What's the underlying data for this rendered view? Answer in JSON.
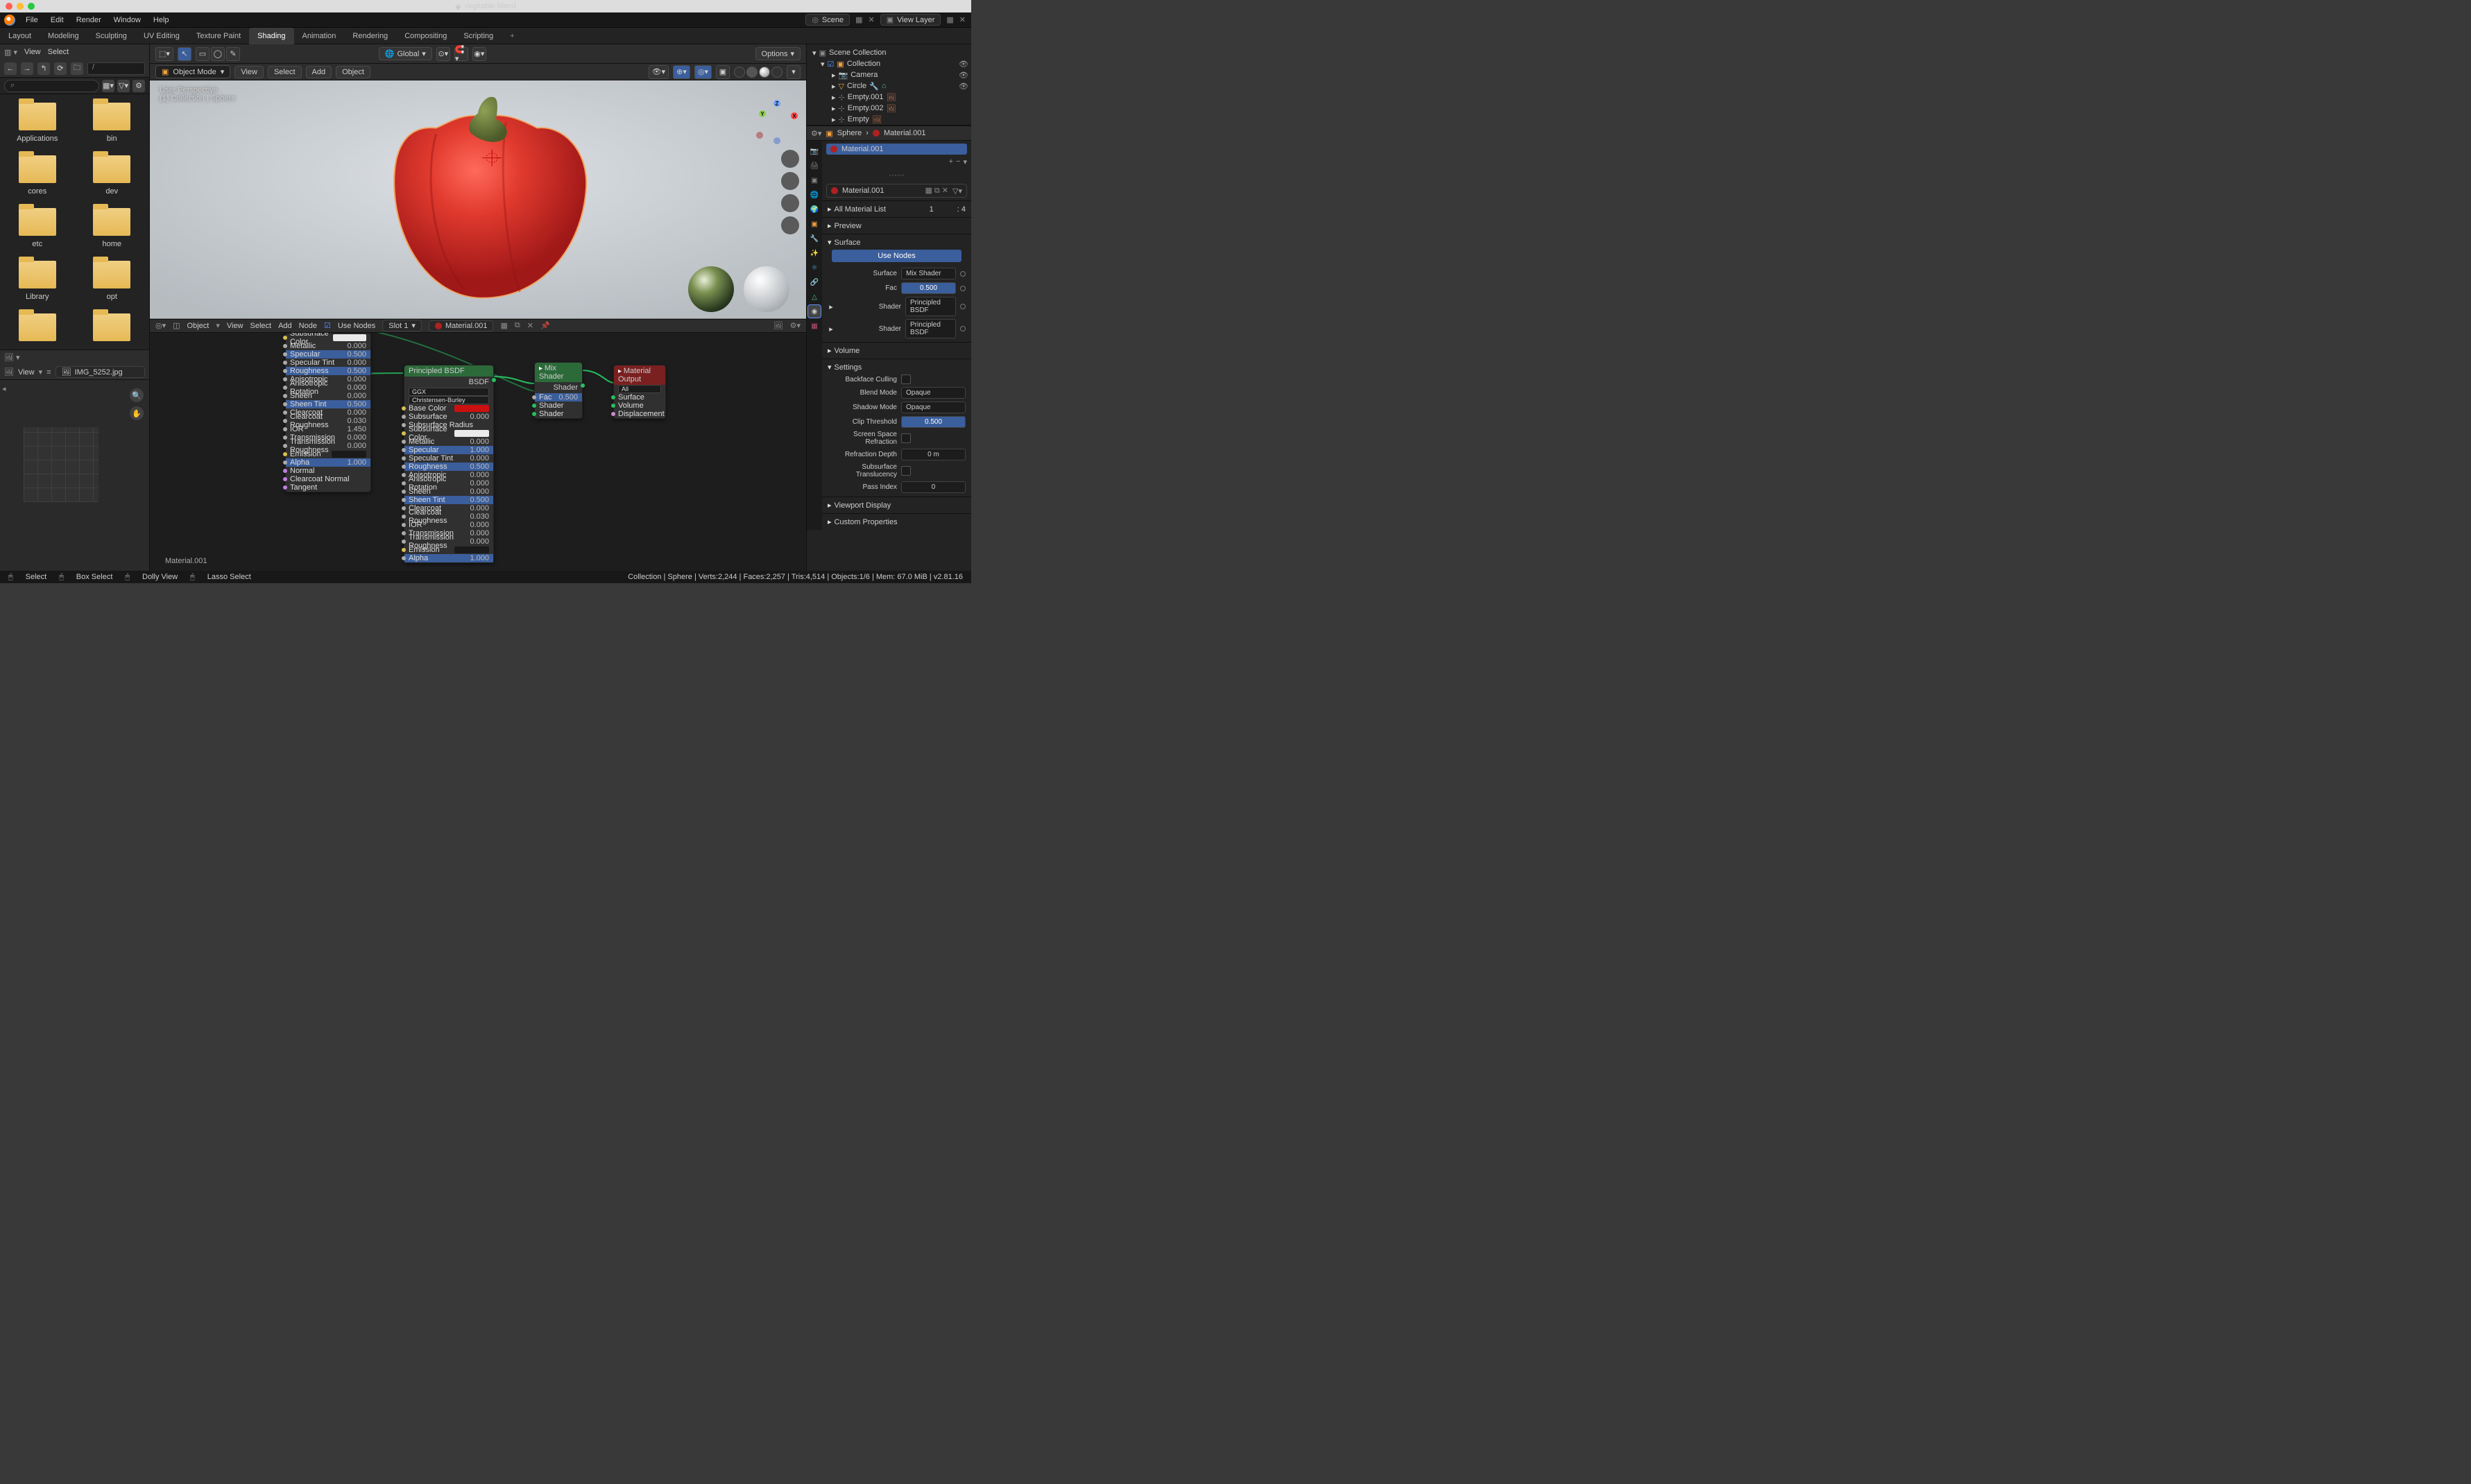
{
  "window_title": "vegitable.blend",
  "menu": [
    "File",
    "Edit",
    "Render",
    "Window",
    "Help"
  ],
  "workspaces": [
    "Layout",
    "Modeling",
    "Sculpting",
    "UV Editing",
    "Texture Paint",
    "Shading",
    "Animation",
    "Rendering",
    "Compositing",
    "Scripting"
  ],
  "active_workspace": "Shading",
  "scene": "Scene",
  "view_layer": "View Layer",
  "file_browser": {
    "menus": [
      "View",
      "Select"
    ],
    "folders": [
      "Applications",
      "bin",
      "cores",
      "dev",
      "etc",
      "home",
      "Library",
      "opt"
    ]
  },
  "image_editor": {
    "menu": "View",
    "file": "IMG_5252.jpg"
  },
  "viewport": {
    "mode": "Object Mode",
    "menus": [
      "View",
      "Select",
      "Add",
      "Object"
    ],
    "orient": "Global",
    "options_label": "Options",
    "persp": "User Perspective",
    "path": "(1) Collection | Sphere"
  },
  "node_editor": {
    "menus": [
      "View",
      "Select",
      "Add",
      "Node"
    ],
    "object": "Object",
    "use_nodes_label": "Use Nodes",
    "slot": "Slot 1",
    "material": "Material.001",
    "label": "Material.001",
    "left_node_rows": [
      {
        "l": "Subsurface Color",
        "color": "#eaeaea"
      },
      {
        "l": "Metallic",
        "v": "0.000"
      },
      {
        "l": "Specular",
        "v": "0.500",
        "h": 1
      },
      {
        "l": "Specular Tint",
        "v": "0.000"
      },
      {
        "l": "Roughness",
        "v": "0.500",
        "h": 1
      },
      {
        "l": "Anisotropic",
        "v": "0.000"
      },
      {
        "l": "Anisotropic Rotation",
        "v": "0.000"
      },
      {
        "l": "Sheen",
        "v": "0.000"
      },
      {
        "l": "Sheen Tint",
        "v": "0.500",
        "h": 1
      },
      {
        "l": "Clearcoat",
        "v": "0.000"
      },
      {
        "l": "Clearcoat Roughness",
        "v": "0.030"
      },
      {
        "l": "IOR",
        "v": "1.450"
      },
      {
        "l": "Transmission",
        "v": "0.000"
      },
      {
        "l": "Transmission Roughness",
        "v": "0.000"
      },
      {
        "l": "Emission",
        "color": "#1a1a1a"
      },
      {
        "l": "Alpha",
        "v": "1.000",
        "h": 1
      },
      {
        "l": "Normal"
      },
      {
        "l": "Clearcoat Normal"
      },
      {
        "l": "Tangent"
      }
    ],
    "principled": {
      "title": "Principled BSDF",
      "out": "BSDF",
      "dist": "GGX",
      "sss": "Christensen-Burley",
      "rows": [
        {
          "l": "Base Color",
          "color": "#cc1010"
        },
        {
          "l": "Subsurface",
          "v": "0.000"
        },
        {
          "l": "Subsurface Radius"
        },
        {
          "l": "Subsurface Color",
          "color": "#eaeaea"
        },
        {
          "l": "Metallic",
          "v": "0.000"
        },
        {
          "l": "Specular",
          "v": "1.000",
          "h": 1
        },
        {
          "l": "Specular Tint",
          "v": "0.000"
        },
        {
          "l": "Roughness",
          "v": "0.500",
          "h": 1
        },
        {
          "l": "Anisotropic",
          "v": "0.000"
        },
        {
          "l": "Anisotropic Rotation",
          "v": "0.000"
        },
        {
          "l": "Sheen",
          "v": "0.000"
        },
        {
          "l": "Sheen Tint",
          "v": "0.500",
          "h": 1
        },
        {
          "l": "Clearcoat",
          "v": "0.000"
        },
        {
          "l": "Clearcoat Roughness",
          "v": "0.030"
        },
        {
          "l": "IOR",
          "v": "0.000"
        },
        {
          "l": "Transmission",
          "v": "0.000"
        },
        {
          "l": "Transmission Roughness",
          "v": "0.000"
        },
        {
          "l": "Emission",
          "color": "#1a1a1a"
        },
        {
          "l": "Alpha",
          "v": "1.000",
          "h": 1
        }
      ]
    },
    "mix": {
      "title": "Mix Shader",
      "out": "Shader",
      "fac": "0.500",
      "s1": "Shader",
      "s2": "Shader"
    },
    "output": {
      "title": "Material Output",
      "target": "All",
      "ins": [
        "Surface",
        "Volume",
        "Displacement"
      ]
    }
  },
  "outliner": {
    "root": "Scene Collection",
    "collection": "Collection",
    "items": [
      "Camera",
      "Circle",
      "Empty.001",
      "Empty.002",
      "Empty"
    ]
  },
  "properties": {
    "breadcrumb_obj": "Sphere",
    "breadcrumb_mat": "Material.001",
    "slot": "Material.001",
    "material_field": "Material.001",
    "sections": {
      "all_materials": "All Material List",
      "all_materials_count": "1",
      "all_materials_total": ": 4",
      "preview": "Preview",
      "surface": "Surface",
      "use_nodes": "Use Nodes",
      "surface_val": "Mix Shader",
      "fac": "Fac",
      "fac_val": "0.500",
      "shader": "Shader",
      "shader_val": "Principled BSDF",
      "volume": "Volume",
      "settings": "Settings",
      "backface": "Backface Culling",
      "blend": "Blend Mode",
      "blend_val": "Opaque",
      "shadow": "Shadow Mode",
      "shadow_val": "Opaque",
      "clip": "Clip Threshold",
      "clip_val": "0.500",
      "ssr": "Screen Space Refraction",
      "refr": "Refraction Depth",
      "refr_val": "0 m",
      "sst": "Subsurface Translucency",
      "pass": "Pass Index",
      "pass_val": "0",
      "vpdisp": "Viewport Display",
      "custom": "Custom Properties"
    }
  },
  "status": {
    "select": "Select",
    "box": "Box Select",
    "dolly": "Dolly View",
    "lasso": "Lasso Select",
    "right": "Collection | Sphere | Verts:2,244 | Faces:2,257 | Tris:4,514 | Objects:1/6 | Mem: 67.0 MiB | v2.81.16"
  }
}
